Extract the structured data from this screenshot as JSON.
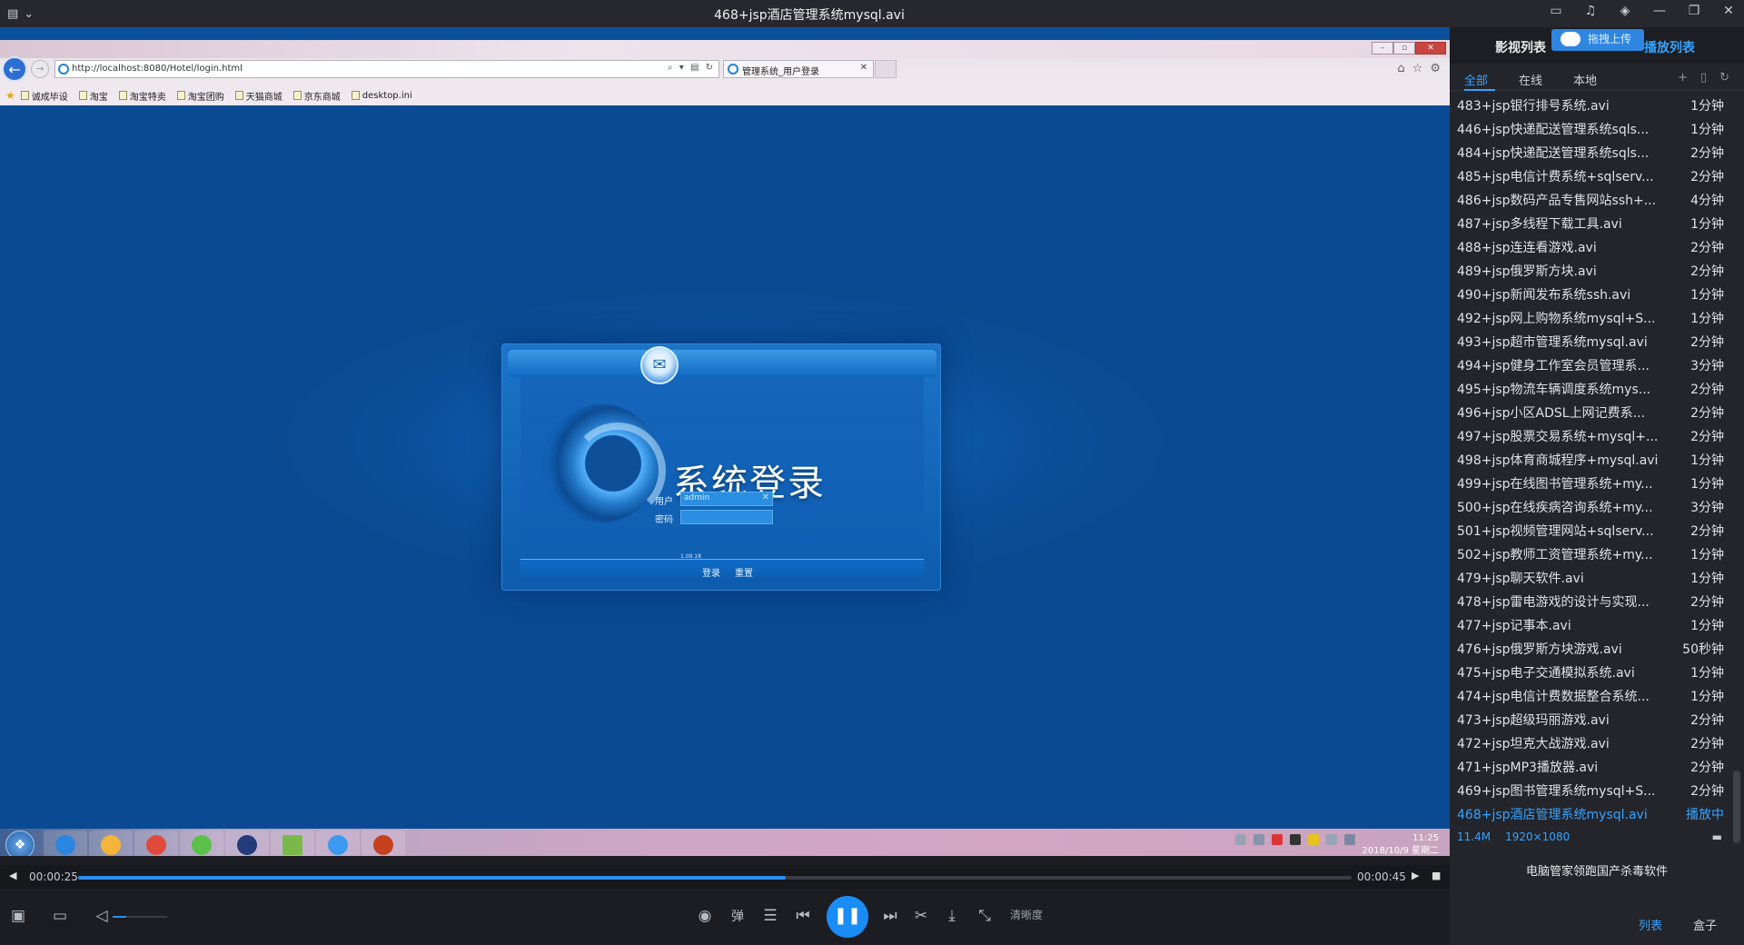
{
  "window": {
    "title": "468+jsp酒店管理系统mysql.avi"
  },
  "browser": {
    "url": "http://localhost:8080/Hotel/login.html",
    "tab_title": "管理系统_用户登录",
    "favorites": [
      "诚成毕设",
      "淘宝",
      "淘宝特卖",
      "淘宝团购",
      "天猫商城",
      "京东商城",
      "desktop.ini"
    ]
  },
  "login": {
    "heading": "系统登录",
    "user_label": "用户",
    "pass_label": "密码",
    "username_value": "admin",
    "login_button": "登录",
    "reset_button": "重置",
    "version": "1.09.18"
  },
  "taskbar": {
    "time": "11:25",
    "date": "2018/10/9 星期二"
  },
  "player": {
    "current_time": "00:00:25",
    "total_time": "00:00:45",
    "progress_fraction": 0.5556,
    "volume_fraction": 0.25,
    "quality_label": "清晰度",
    "danmaku_label": "弹"
  },
  "playlist": {
    "title": "影视列表",
    "upload_label": "拖拽上传",
    "play_list_title": "播放列表",
    "tabs": [
      "全部",
      "在线",
      "本地"
    ],
    "items": [
      {
        "name": "483+jsp银行排号系统.avi",
        "duration": "1分钟"
      },
      {
        "name": "446+jsp快递配送管理系统sqls...",
        "duration": "1分钟"
      },
      {
        "name": "484+jsp快递配送管理系统sqls...",
        "duration": "2分钟"
      },
      {
        "name": "485+jsp电信计费系统+sqlserv...",
        "duration": "2分钟"
      },
      {
        "name": "486+jsp数码产品专售网站ssh+...",
        "duration": "4分钟"
      },
      {
        "name": "487+jsp多线程下载工具.avi",
        "duration": "1分钟"
      },
      {
        "name": "488+jsp连连看游戏.avi",
        "duration": "2分钟"
      },
      {
        "name": "489+jsp俄罗斯方块.avi",
        "duration": "2分钟"
      },
      {
        "name": "490+jsp新闻发布系统ssh.avi",
        "duration": "1分钟"
      },
      {
        "name": "492+jsp网上购物系统mysql+S...",
        "duration": "1分钟"
      },
      {
        "name": "493+jsp超市管理系统mysql.avi",
        "duration": "2分钟"
      },
      {
        "name": "494+jsp健身工作室会员管理系...",
        "duration": "3分钟"
      },
      {
        "name": "495+jsp物流车辆调度系统mys...",
        "duration": "2分钟"
      },
      {
        "name": "496+jsp小区ADSL上网记费系...",
        "duration": "2分钟"
      },
      {
        "name": "497+jsp股票交易系统+mysql+...",
        "duration": "2分钟"
      },
      {
        "name": "498+jsp体育商城程序+mysql.avi",
        "duration": "1分钟"
      },
      {
        "name": "499+jsp在线图书管理系统+my...",
        "duration": "1分钟"
      },
      {
        "name": "500+jsp在线疾病咨询系统+my...",
        "duration": "3分钟"
      },
      {
        "name": "501+jsp视频管理网站+sqlserv...",
        "duration": "2分钟"
      },
      {
        "name": "502+jsp教师工资管理系统+my...",
        "duration": "1分钟"
      },
      {
        "name": "479+jsp聊天软件.avi",
        "duration": "1分钟"
      },
      {
        "name": "478+jsp雷电游戏的设计与实现...",
        "duration": "2分钟"
      },
      {
        "name": "477+jsp记事本.avi",
        "duration": "1分钟"
      },
      {
        "name": "476+jsp俄罗斯方块游戏.avi",
        "duration": "50秒钟"
      },
      {
        "name": "475+jsp电子交通模拟系统.avi",
        "duration": "1分钟"
      },
      {
        "name": "474+jsp电信计费数据整合系统...",
        "duration": "1分钟"
      },
      {
        "name": "473+jsp超级玛丽游戏.avi",
        "duration": "2分钟"
      },
      {
        "name": "472+jsp坦克大战游戏.avi",
        "duration": "2分钟"
      },
      {
        "name": "471+jspMP3播放器.avi",
        "duration": "2分钟"
      },
      {
        "name": "469+jsp图书管理系统mysql+S...",
        "duration": "2分钟"
      },
      {
        "name": "468+jsp酒店管理系统mysql.avi",
        "duration": "播放中"
      }
    ],
    "current_size": "11.4M",
    "current_resolution": "1920×1080",
    "ad_text": "电脑管家领跑国产杀毒软件",
    "bottom_tabs": [
      "列表",
      "盒子"
    ]
  },
  "colors": {
    "accent": "#1a8cf5",
    "playing": "#36a3ff",
    "panel_bg": "#23252b"
  }
}
